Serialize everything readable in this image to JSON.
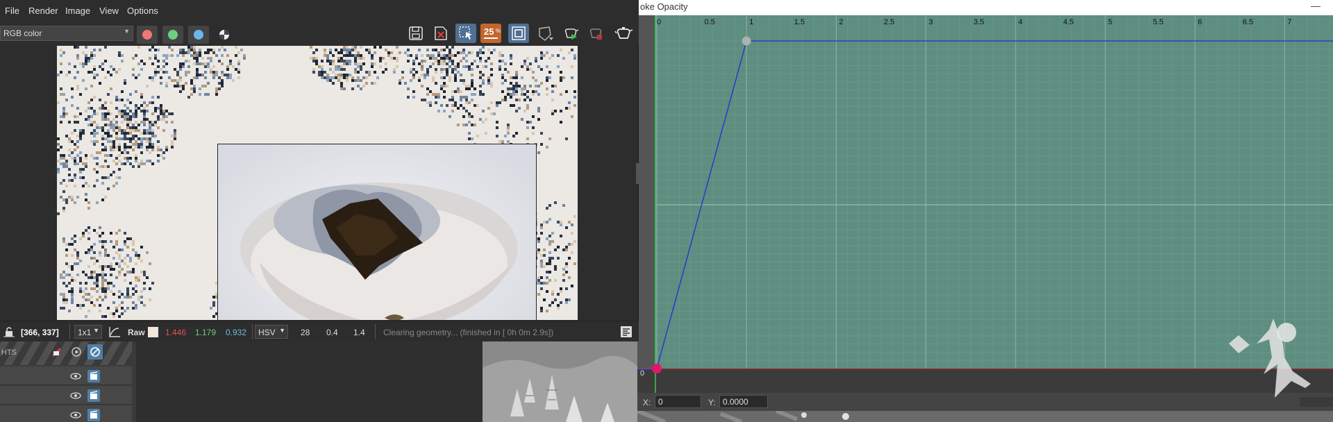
{
  "render_window": {
    "menu": [
      "File",
      "Render",
      "Image",
      "View",
      "Options"
    ],
    "channel": "RGB color",
    "sample_badge": "25",
    "colors": {
      "red_dot": "#f07878",
      "green_dot": "#6fcf7f",
      "blue_dot": "#6ab8e8",
      "accent_orange": "#c1662f",
      "active_blue": "#4f6f93"
    },
    "toolbar_icons": [
      "save-icon",
      "clear-icon",
      "region-select-icon",
      "samples-icon",
      "render-region-icon",
      "shader-ball-icon",
      "teapot-play-icon",
      "teapot-stop-icon",
      "teapot-icon"
    ],
    "status": {
      "pixel": "[366, 337]",
      "zoom": "1x1",
      "mode": "Raw",
      "r": "1.446",
      "g": "1.179",
      "b": "0.932",
      "colorspace": "HSV",
      "h": "28",
      "s": "0.4",
      "v": "1.4",
      "message": "Clearing geometry... (finished in [ 0h  0m  2.9s])"
    }
  },
  "left_panel": {
    "header": "HTS"
  },
  "graph": {
    "title": "oke Opacity",
    "x_ticks": [
      "0",
      "0.5",
      "1",
      "1.5",
      "2",
      "2.5",
      "3",
      "3.5",
      "4",
      "4.5",
      "5",
      "5.5",
      "6",
      "6.5",
      "7",
      "7"
    ],
    "y_label": "0",
    "keys": [
      {
        "x": 0,
        "y": 0
      },
      {
        "x": 1,
        "y": 1
      }
    ],
    "coords": {
      "x_label": "X:",
      "x_value": "0",
      "y_label": "Y:",
      "y_value": "0.0000"
    },
    "colors": {
      "bg": "#5e8e80",
      "curve": "#2a3fc8",
      "key_active": "#e0186a",
      "key": "#a8b4b0"
    }
  }
}
